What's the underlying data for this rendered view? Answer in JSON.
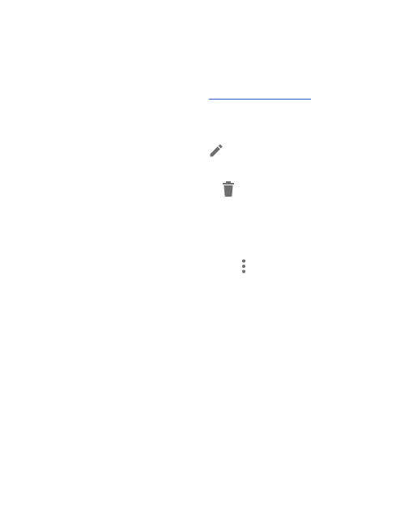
{
  "icons": {
    "edit": "edit-pencil-icon",
    "delete": "trash-icon",
    "more": "more-vertical-icon"
  },
  "colors": {
    "icon": "#6f6f6f",
    "link_underline": "#3b5bdb",
    "background": "#ffffff"
  }
}
